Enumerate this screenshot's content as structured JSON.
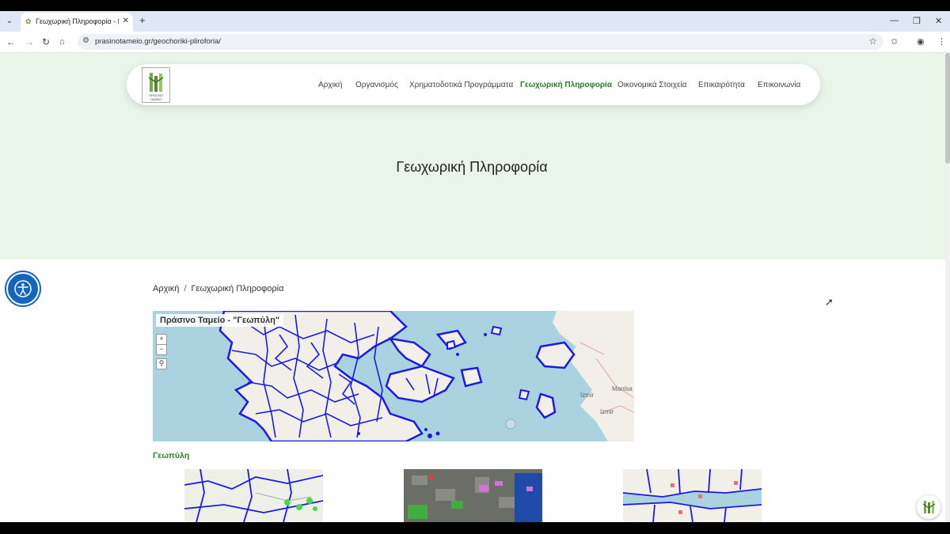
{
  "browser": {
    "tab_title": "Γεωχωρική Πληροφορία - Πρ",
    "url": "prasinotameio.gr/geochoriki-pliroforia/",
    "icons": [
      "tab-list-icon",
      "favicon-icon",
      "close-icon",
      "new-tab-icon",
      "minimize-icon",
      "restore-icon",
      "window-close-icon",
      "back-icon",
      "forward-icon",
      "reload-icon",
      "home-icon",
      "site-info-icon",
      "bookmark-star-icon",
      "extensions-icon",
      "profile-icon",
      "more-menu-icon"
    ]
  },
  "site": {
    "logo_text": "ΠΡΑΣΙΝΟ ΤΑΜΕΙΟ",
    "nav": [
      {
        "label": "Αρχική"
      },
      {
        "label": "Οργανισμός"
      },
      {
        "label": "Χρηματοδοτικά Προγράμματα"
      },
      {
        "label": "Γεωχωρική Πληροφορία"
      },
      {
        "label": "Οικονομικά Στοιχεία"
      },
      {
        "label": "Επικαιρότητα"
      },
      {
        "label": "Επικοινωνία"
      }
    ],
    "active_nav": "Γεωχωρική Πληροφορία",
    "hero_title": "Γεωχωρική Πληροφορία",
    "breadcrumb": {
      "home": "Αρχική",
      "separator": "/",
      "current": "Γεωχωρική Πληροφορία"
    },
    "map": {
      "title": "Πράσινο Ταμείο - \"Γεωπύλη\"",
      "zoom_in": "+",
      "zoom_out": "−",
      "cities": [
        "Manisa",
        "Izmir",
        "İzmir"
      ]
    },
    "section_label": "Γεωπύλη",
    "colors": {
      "accent_green": "#2d7a2d",
      "hero_bg": "#e9f5e8",
      "boundary_blue": "#1a1ae6",
      "accessibility_blue": "#1565c0"
    }
  }
}
